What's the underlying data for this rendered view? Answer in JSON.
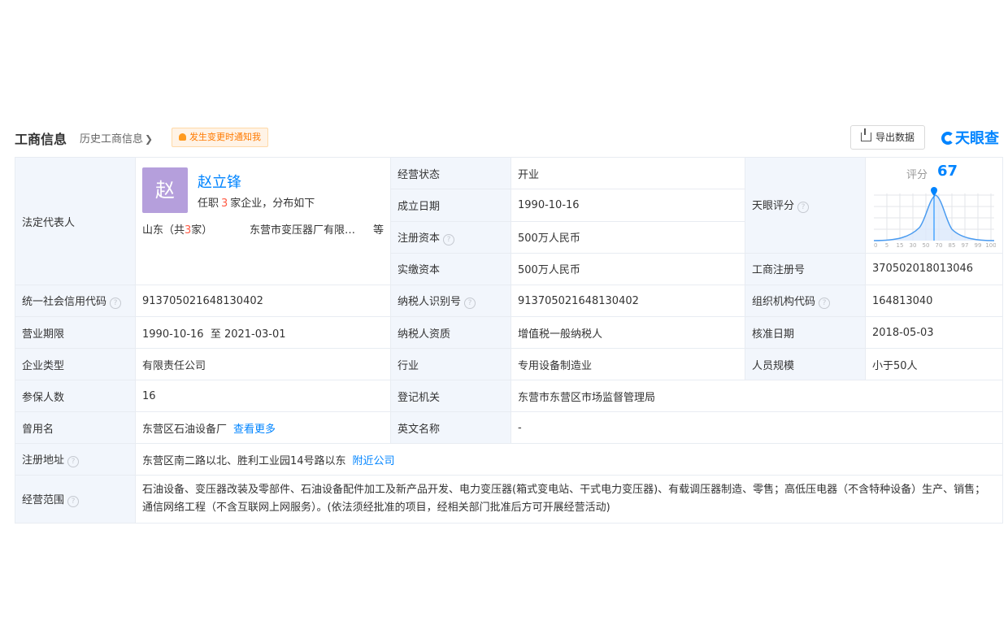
{
  "header": {
    "title": "工商信息",
    "history_link": "历史工商信息",
    "notify_label": "发生变更时通知我",
    "export_label": "导出数据",
    "logo_text": "天眼查"
  },
  "legal_rep": {
    "label": "法定代表人",
    "avatar_char": "赵",
    "name": "赵立锋",
    "positions_prefix": "任职",
    "positions_count": "3",
    "positions_suffix": "家企业，分布如下",
    "region_prefix": "山东（共",
    "region_count": "3",
    "region_suffix": "家）",
    "company": "东营市变压器厂有限公司",
    "etc": "等"
  },
  "rows_top": [
    {
      "label": "经营状态",
      "value": "开业"
    },
    {
      "label": "成立日期",
      "value": "1990-10-16"
    },
    {
      "label": "注册资本",
      "value": "500万人民币"
    },
    {
      "label": "实缴资本",
      "value": "500万人民币"
    }
  ],
  "tianyan": {
    "label": "天眼评分",
    "score_label": "评分",
    "score": "67",
    "axis_ticks": [
      "0",
      "5",
      "15",
      "30",
      "50",
      "70",
      "85",
      "97",
      "99",
      "100"
    ]
  },
  "reg_no": {
    "label": "工商注册号",
    "value": "370502018013046"
  },
  "rows": [
    [
      {
        "label": "统一社会信用代码",
        "value": "913705021648130402",
        "help": true
      },
      {
        "label": "纳税人识别号",
        "value": "913705021648130402",
        "help": true
      },
      {
        "label": "组织机构代码",
        "value": "164813040",
        "help": true
      }
    ],
    [
      {
        "label": "营业期限",
        "value": "1990-10-16  至 2021-03-01"
      },
      {
        "label": "纳税人资质",
        "value": "增值税一般纳税人"
      },
      {
        "label": "核准日期",
        "value": "2018-05-03"
      }
    ],
    [
      {
        "label": "企业类型",
        "value": "有限责任公司"
      },
      {
        "label": "行业",
        "value": "专用设备制造业"
      },
      {
        "label": "人员规模",
        "value": "小于50人"
      }
    ]
  ],
  "insured": {
    "label": "参保人数",
    "value": "16"
  },
  "registrar": {
    "label": "登记机关",
    "value": "东营市东营区市场监督管理局"
  },
  "former_name": {
    "label": "曾用名",
    "value": "东营区石油设备厂",
    "link": "查看更多"
  },
  "english_name": {
    "label": "英文名称",
    "value": "-"
  },
  "address": {
    "label": "注册地址",
    "value": "东营区南二路以北、胜利工业园14号路以东",
    "link": "附近公司"
  },
  "scope": {
    "label": "经营范围",
    "value": "石油设备、变压器改装及零部件、石油设备配件加工及新产品开发、电力变压器(箱式变电站、干式电力变压器)、有载调压器制造、零售；高低压电器（不含特种设备）生产、销售；通信网络工程（不含互联网上网服务）。(依法须经批准的项目，经相关部门批准后方可开展经营活动)"
  },
  "colors": {
    "accent": "#0084ff",
    "label_bg": "#f2f6fc",
    "highlight": "#ff5a44"
  }
}
